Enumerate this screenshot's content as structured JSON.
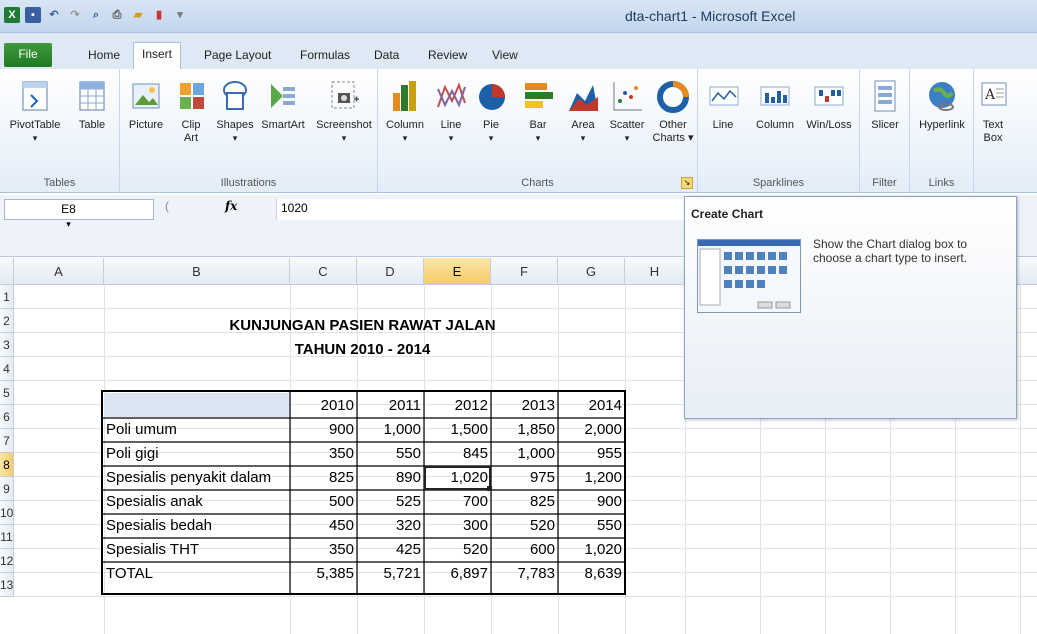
{
  "window": {
    "title": "dta-chart1 - Microsoft Excel"
  },
  "tabs": [
    {
      "label": "File"
    },
    {
      "label": "Home"
    },
    {
      "label": "Insert"
    },
    {
      "label": "Page Layout"
    },
    {
      "label": "Formulas"
    },
    {
      "label": "Data"
    },
    {
      "label": "Review"
    },
    {
      "label": "View"
    }
  ],
  "ribbon": {
    "tables": {
      "label": "Tables",
      "pivot": "PivotTable",
      "table": "Table"
    },
    "illustrations": {
      "label": "Illustrations",
      "picture": "Picture",
      "clip1": "Clip",
      "clip2": "Art",
      "shapes": "Shapes",
      "smartart": "SmartArt",
      "screenshot": "Screenshot"
    },
    "charts": {
      "label": "Charts",
      "column": "Column",
      "line": "Line",
      "pie": "Pie",
      "bar": "Bar",
      "area": "Area",
      "scatter": "Scatter",
      "other1": "Other",
      "other2": "Charts ▾"
    },
    "sparklines": {
      "label": "Sparklines",
      "line": "Line",
      "column": "Column",
      "winloss": "Win/Loss"
    },
    "filter": {
      "label": "Filter",
      "slicer": "Slicer"
    },
    "links": {
      "label": "Links",
      "hyperlink": "Hyperlink"
    },
    "text": {
      "t1": "Text",
      "t2": "Box"
    }
  },
  "formula": {
    "namebox": "E8",
    "fx": "fx",
    "value": "1020"
  },
  "tooltip": {
    "title": "Create Chart",
    "desc": "Show the Chart dialog box to choose a chart type to insert."
  },
  "columns": [
    "A",
    "B",
    "C",
    "D",
    "E",
    "F",
    "G",
    "H"
  ],
  "rows": [
    "1",
    "2",
    "3",
    "4",
    "5",
    "6",
    "7",
    "8",
    "9",
    "10",
    "11",
    "12",
    "13"
  ],
  "sheet": {
    "title1": "KUNJUNGAN PASIEN RAWAT JALAN",
    "title2": "TAHUN 2010 - 2014",
    "years": [
      "2010",
      "2011",
      "2012",
      "2013",
      "2014"
    ],
    "data": [
      {
        "label": "Poli umum",
        "v": [
          "900",
          "1,000",
          "1,500",
          "1,850",
          "2,000"
        ]
      },
      {
        "label": "Poli gigi",
        "v": [
          "350",
          "550",
          "845",
          "1,000",
          "955"
        ]
      },
      {
        "label": "Spesialis penyakit dalam",
        "v": [
          "825",
          "890",
          "1,020",
          "975",
          "1,200"
        ]
      },
      {
        "label": "Spesialis anak",
        "v": [
          "500",
          "525",
          "700",
          "825",
          "900"
        ]
      },
      {
        "label": "Spesialis bedah",
        "v": [
          "450",
          "320",
          "300",
          "520",
          "550"
        ]
      },
      {
        "label": "Spesialis THT",
        "v": [
          "350",
          "425",
          "520",
          "600",
          "1,020"
        ]
      },
      {
        "label": "TOTAL",
        "v": [
          "5,385",
          "5,721",
          "6,897",
          "7,783",
          "8,639"
        ]
      }
    ]
  }
}
